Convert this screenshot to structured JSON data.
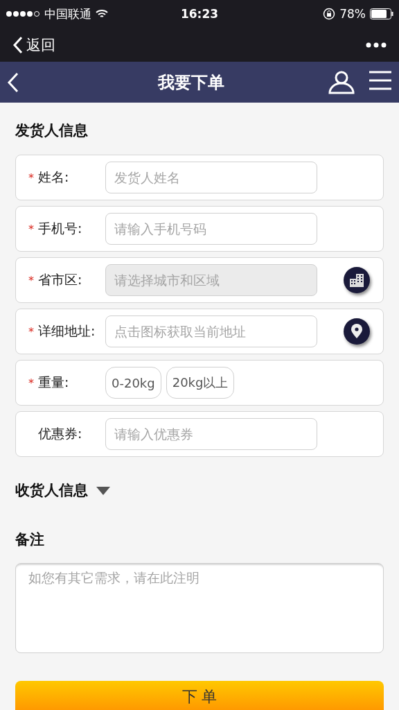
{
  "status_bar": {
    "carrier": "中国联通",
    "time": "16:23",
    "battery": "78%"
  },
  "wechat_bar": {
    "back": "返回"
  },
  "header": {
    "title": "我要下单"
  },
  "sender": {
    "title": "发货人信息",
    "fields": [
      {
        "kind": "input",
        "required_mark": "*",
        "label": "姓名:",
        "placeholder": "发货人姓名",
        "readonly": false
      },
      {
        "kind": "input",
        "required_mark": "*",
        "label": "手机号:",
        "placeholder": "请输入手机号码",
        "readonly": false
      },
      {
        "kind": "input",
        "required_mark": "*",
        "label": "省市区:",
        "placeholder": "请选择城市和区域",
        "readonly": true,
        "action": {
          "kind": "buildings"
        }
      },
      {
        "kind": "input",
        "required_mark": "*",
        "label": "详细地址:",
        "placeholder": "点击图标获取当前地址",
        "readonly": false,
        "action": {
          "kind": "location"
        }
      },
      {
        "kind": "choice",
        "required_mark": "*",
        "label": "重量:",
        "options": [
          {
            "label": "0-20kg",
            "selected": false
          },
          {
            "label": "20kg以上",
            "selected": false
          }
        ]
      },
      {
        "kind": "input",
        "label": "优惠券:",
        "placeholder": "请输入优惠券",
        "readonly": false
      }
    ]
  },
  "receiver": {
    "title": "收货人信息",
    "expanded": false
  },
  "notes": {
    "title": "备注",
    "placeholder": "如您有其它需求，请在此注明"
  },
  "submit": {
    "label": "下 单"
  }
}
